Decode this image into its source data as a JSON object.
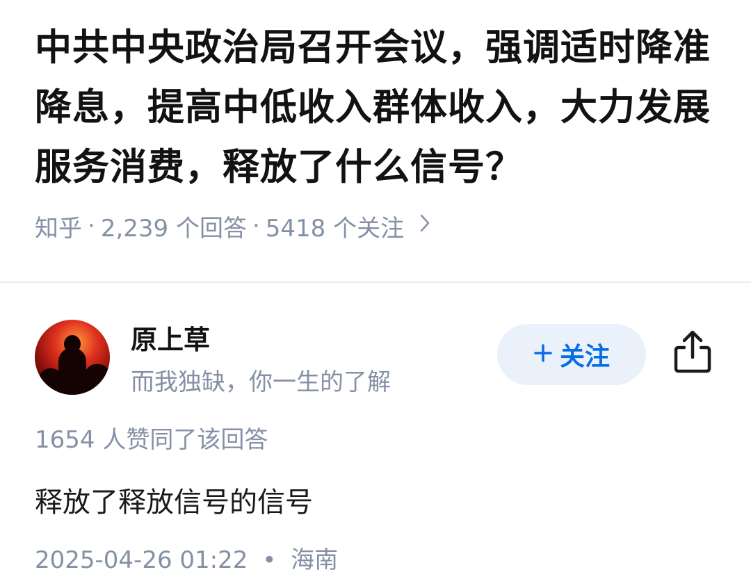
{
  "question": {
    "title": "中共中央政治局召开会议，强调适时降准降息，提高中低收入群体收入，大力发展服务消费，释放了什么信号？",
    "source": "知乎",
    "answer_count": "2,239 个回答",
    "follower_count": "5418 个关注",
    "separator": "·",
    "more_icon": "chevron-right-icon"
  },
  "answer": {
    "author": {
      "name": "原上草",
      "bio": "而我独缺，你一生的了解",
      "avatar": "avatar-image"
    },
    "follow_button": {
      "icon": "plus",
      "label": "关注"
    },
    "share_icon": "share-icon",
    "upvotes": "1654 人赞同了该回答",
    "content": "释放了释放信号的信号",
    "timestamp": "2025-04-26 01:22",
    "location_separator": "•",
    "location": "海南"
  },
  "colors": {
    "accent": "#056de8",
    "accent_bg": "#eaf1fb",
    "meta_text": "#8590a6",
    "title_text": "#121212"
  }
}
